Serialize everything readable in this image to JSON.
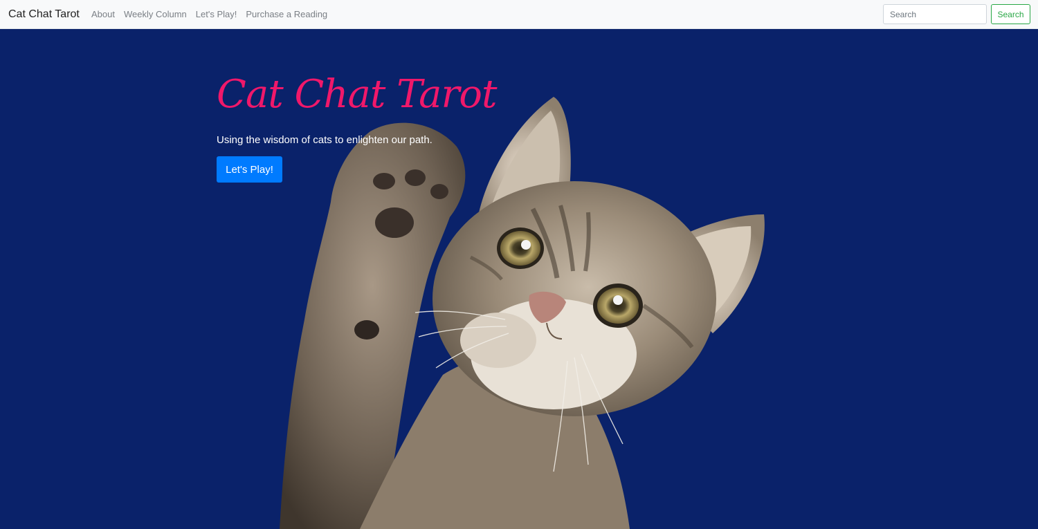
{
  "navbar": {
    "brand": "Cat Chat Tarot",
    "links": [
      {
        "label": "About"
      },
      {
        "label": "Weekly Column"
      },
      {
        "label": "Let's Play!"
      },
      {
        "label": "Purchase a Reading"
      }
    ],
    "search": {
      "placeholder": "Search",
      "value": "",
      "button_label": "Search"
    }
  },
  "hero": {
    "title": "Cat Chat Tarot",
    "tagline": "Using the wisdom of cats to enlighten our path.",
    "button_label": "Let's Play!",
    "image_subject": "tabby-kitten-raising-paw",
    "colors": {
      "background": "#0a226a",
      "title": "#f0186a",
      "button": "#007bff",
      "search_accent": "#28a745"
    }
  }
}
